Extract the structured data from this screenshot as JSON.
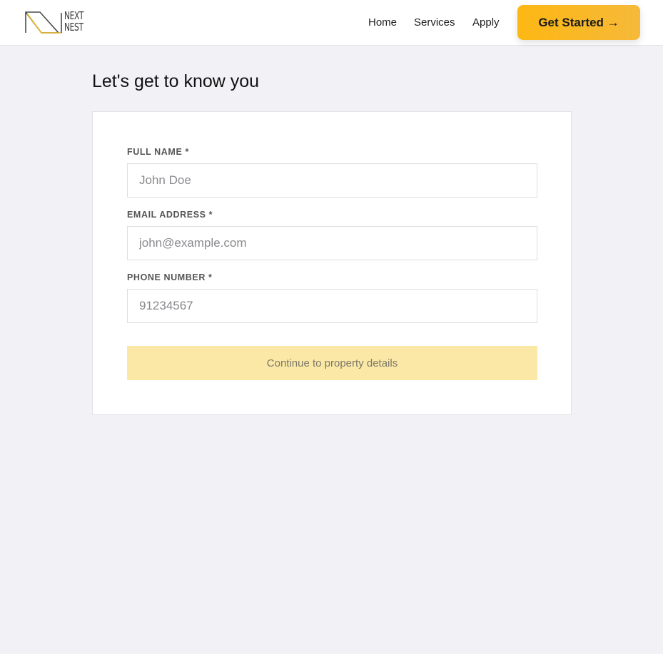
{
  "brand": {
    "logo_line1": "NEXT",
    "logo_line2": "NEST",
    "accent_color": "#fdb813"
  },
  "nav": {
    "items": [
      {
        "label": "Home"
      },
      {
        "label": "Services"
      },
      {
        "label": "Apply"
      }
    ],
    "cta_label": "Get Started →"
  },
  "page": {
    "title": "Let's get to know you"
  },
  "form": {
    "fields": [
      {
        "label": "FULL NAME *",
        "placeholder": "John Doe",
        "value": ""
      },
      {
        "label": "EMAIL ADDRESS *",
        "placeholder": "john@example.com",
        "value": ""
      },
      {
        "label": "PHONE NUMBER *",
        "placeholder": "91234567",
        "value": ""
      }
    ],
    "submit_label": "Continue to property details",
    "submit_state": "disabled"
  }
}
